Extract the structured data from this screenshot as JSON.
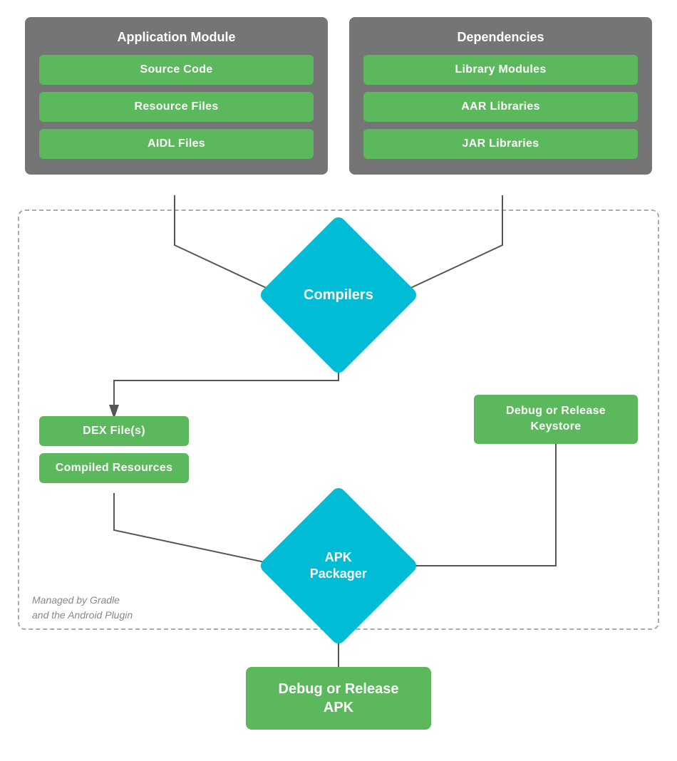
{
  "app_module": {
    "title": "Application Module",
    "items": [
      "Source Code",
      "Resource Files",
      "AIDL Files"
    ]
  },
  "dependencies": {
    "title": "Dependencies",
    "items": [
      "Library Modules",
      "AAR Libraries",
      "JAR Libraries"
    ]
  },
  "compilers": {
    "label": "Compilers"
  },
  "middle_left": {
    "items": [
      "DEX File(s)",
      "Compiled Resources"
    ]
  },
  "middle_right": {
    "label": "Debug or Release\nKeystore"
  },
  "apk_packager": {
    "label": "APK\nPackager"
  },
  "final_apk": {
    "label": "Debug or Release\nAPK"
  },
  "gradle_label": {
    "line1": "Managed by Gradle",
    "line2": "and the Android Plugin"
  }
}
